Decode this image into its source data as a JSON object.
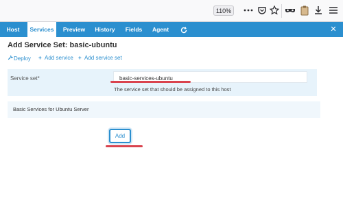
{
  "browser": {
    "zoom": "110%",
    "icons": [
      "more-icon",
      "pocket-icon",
      "bookmark-star-icon",
      "mask-icon",
      "clipboard-icon",
      "download-icon",
      "menu-icon"
    ]
  },
  "nav": {
    "tabs": [
      {
        "label": "Host",
        "active": false
      },
      {
        "label": "Services",
        "active": true
      },
      {
        "label": "Preview",
        "active": false
      },
      {
        "label": "History",
        "active": false
      },
      {
        "label": "Fields",
        "active": false
      },
      {
        "label": "Agent",
        "active": false
      }
    ],
    "close": "✕"
  },
  "page": {
    "title": "Add Service Set: basic-ubuntu",
    "actions": [
      {
        "label": "Deploy",
        "icon": "wrench-icon"
      },
      {
        "label": "Add service",
        "icon": "plus-icon"
      },
      {
        "label": "Add service set",
        "icon": "plus-icon"
      }
    ],
    "field": {
      "label": "Service set*",
      "value": "basic-services-ubuntu",
      "help": "The service set that should be assigned to this host"
    },
    "description": "Basic Services for Ubuntu Server",
    "add_button": "Add"
  },
  "colors": {
    "accent": "#2b8fcf",
    "annotation": "#d9434e"
  }
}
